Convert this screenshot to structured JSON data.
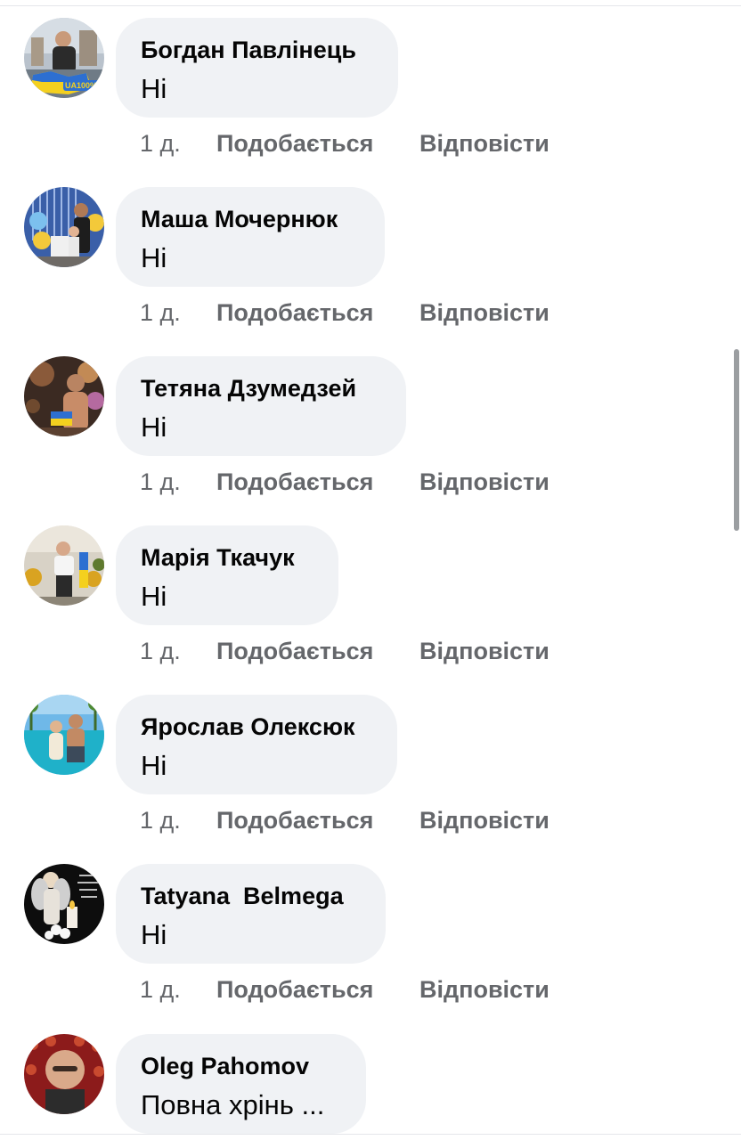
{
  "colors": {
    "bubble": "#f0f2f5",
    "text": "#050505",
    "secondary_text": "#65676b"
  },
  "comments": [
    {
      "author": "Богдан Павлінець",
      "text": "Ні",
      "time": "1 д.",
      "like": "Подобається",
      "reply": "Відповісти",
      "avatar_icon": "profile-photo-avatar",
      "avatar_overlay": "UA100%"
    },
    {
      "author": "Маша Мочернюк",
      "text": "Ні",
      "time": "1 д.",
      "like": "Подобається",
      "reply": "Відповісти",
      "avatar_icon": "profile-photo-avatar"
    },
    {
      "author": "Тетяна Дзумедзей",
      "text": "Ні",
      "time": "1 д.",
      "like": "Подобається",
      "reply": "Відповісти",
      "avatar_icon": "profile-photo-avatar"
    },
    {
      "author": "Марія Ткачук",
      "text": "Ні",
      "time": "1 д.",
      "like": "Подобається",
      "reply": "Відповісти",
      "avatar_icon": "profile-photo-avatar"
    },
    {
      "author": "Ярослав Олексюк",
      "text": "Ні",
      "time": "1 д.",
      "like": "Подобається",
      "reply": "Відповісти",
      "avatar_icon": "profile-photo-avatar"
    },
    {
      "author": "Tatyana  Belmega",
      "text": "Ні",
      "time": "1 д.",
      "like": "Подобається",
      "reply": "Відповісти",
      "avatar_icon": "profile-photo-avatar"
    },
    {
      "author": "Oleg Pahomov",
      "text": "Повна хрінь ...",
      "time": "",
      "like": "",
      "reply": "",
      "avatar_icon": "profile-photo-avatar"
    }
  ]
}
